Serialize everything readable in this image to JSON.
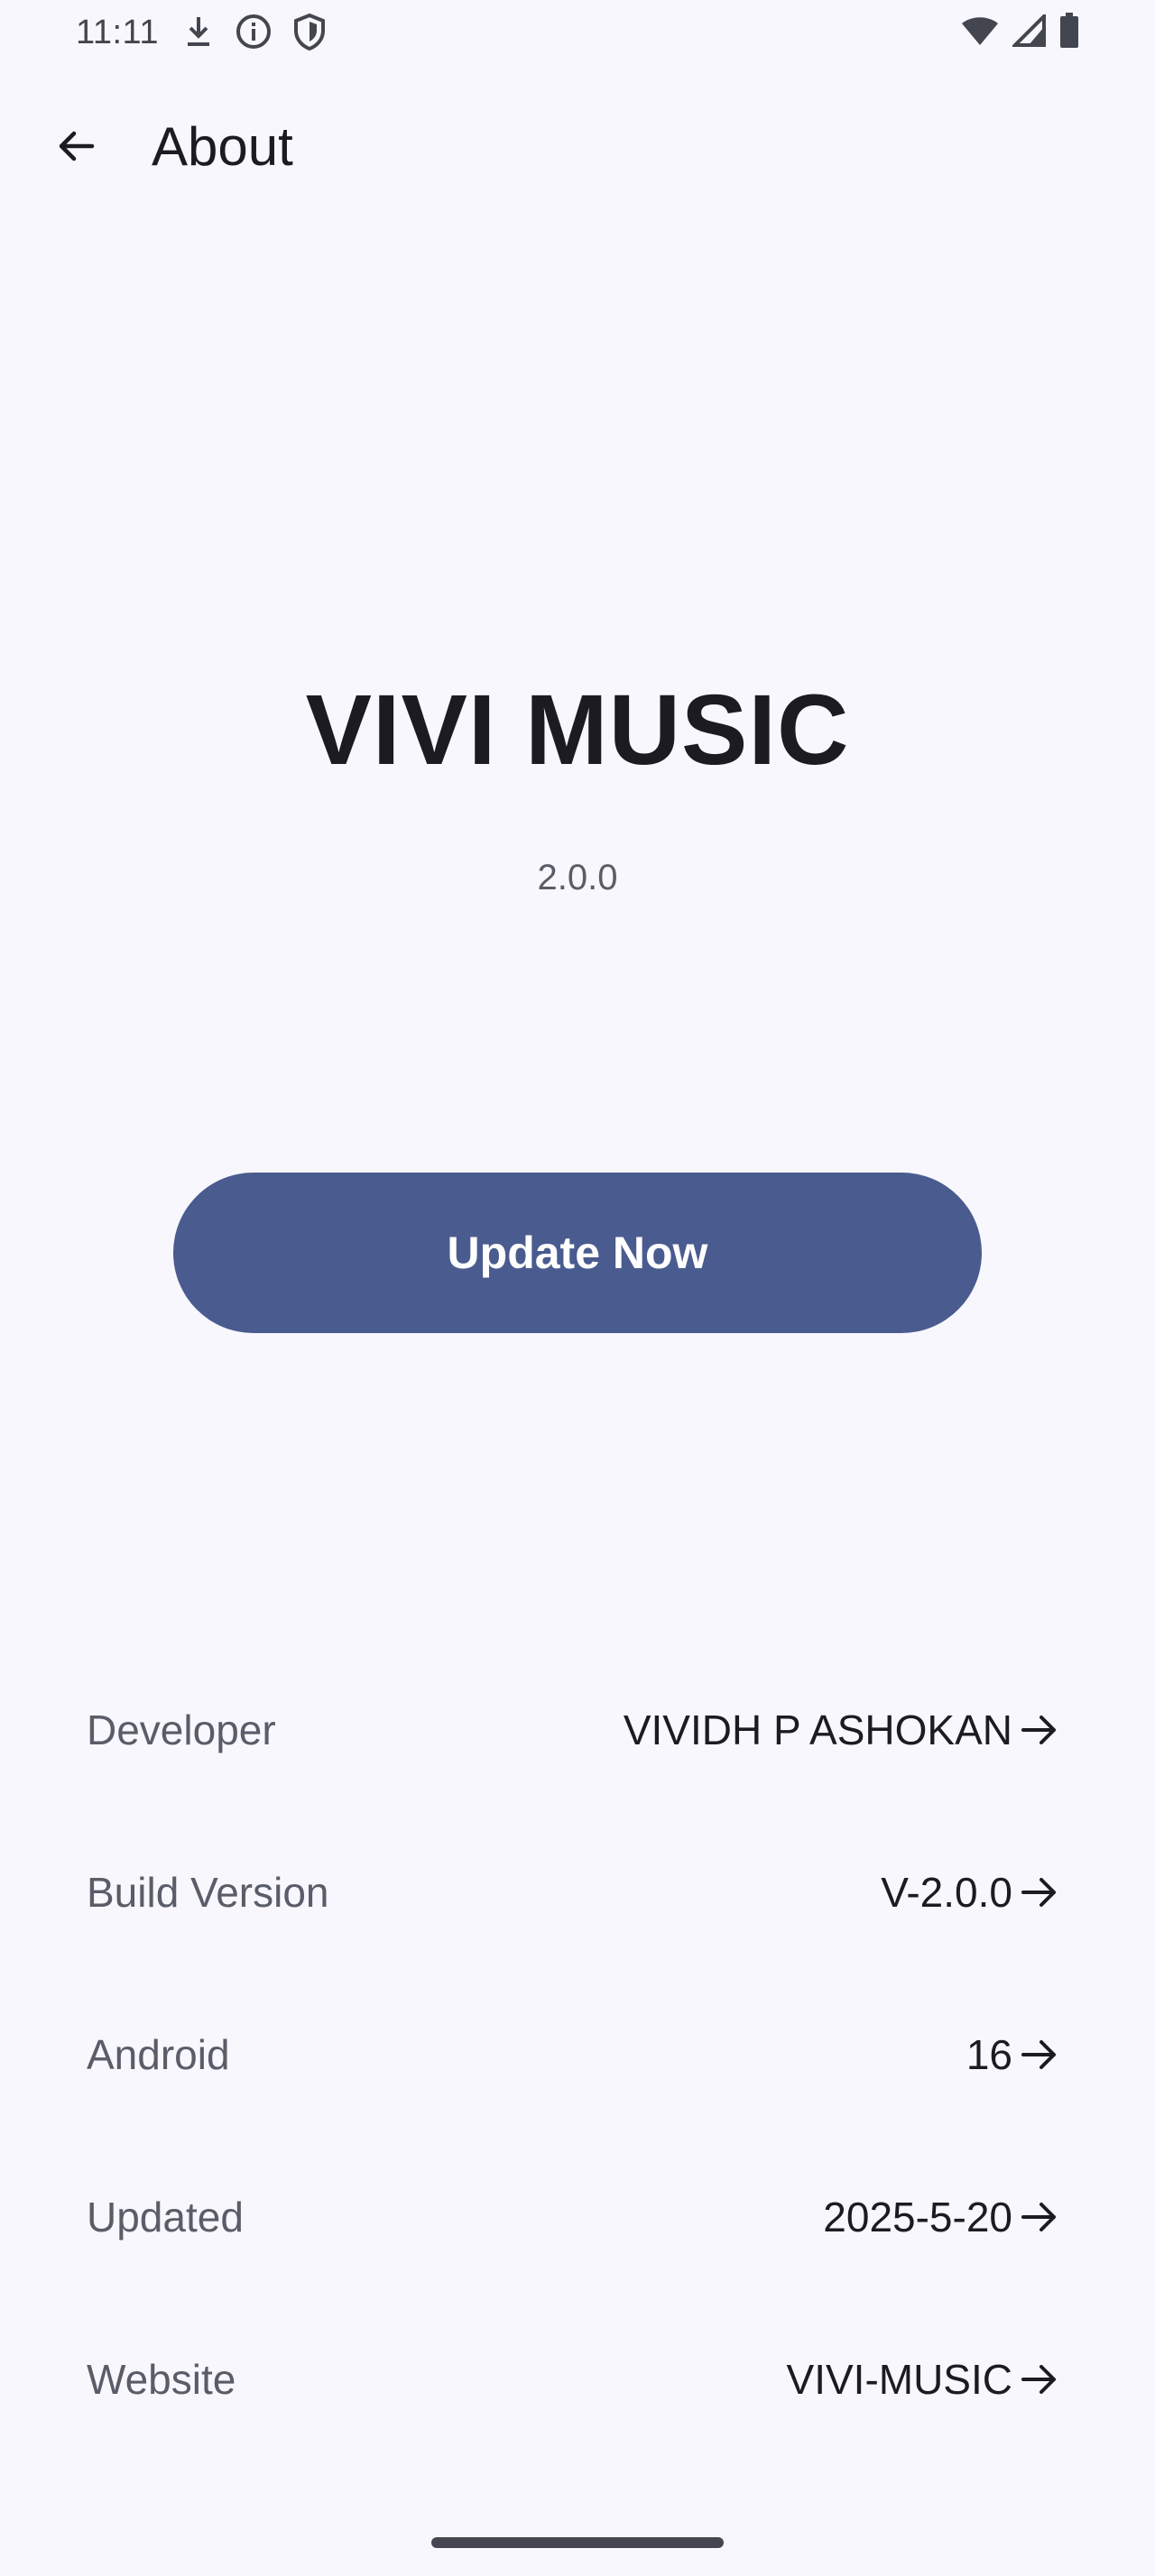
{
  "status_bar": {
    "time": "11:11",
    "left_icons": [
      "download-icon",
      "info-icon",
      "shield-icon"
    ],
    "right_icons": [
      "wifi-icon",
      "signal-icon",
      "battery-icon"
    ]
  },
  "app_bar": {
    "back_icon": "arrow-left-icon",
    "title": "About"
  },
  "hero": {
    "app_name": "VIVI MUSIC",
    "version": "2.0.0"
  },
  "update_button": {
    "label": "Update Now",
    "color": "#4a5b8f"
  },
  "info_rows": [
    {
      "label": "Developer",
      "value": "VIVIDH P ASHOKAN",
      "icon": "arrow-right-icon"
    },
    {
      "label": "Build Version",
      "value": "V-2.0.0",
      "icon": "arrow-right-icon"
    },
    {
      "label": "Android",
      "value": "16",
      "icon": "arrow-right-icon"
    },
    {
      "label": "Updated",
      "value": "2025-5-20",
      "icon": "arrow-right-icon"
    },
    {
      "label": "Website",
      "value": "VIVI-MUSIC",
      "icon": "arrow-right-icon"
    }
  ],
  "colors": {
    "background": "#f7f7fd",
    "text_primary": "#1b1b21",
    "text_secondary": "#5a5d68",
    "accent": "#4a5b8f"
  }
}
